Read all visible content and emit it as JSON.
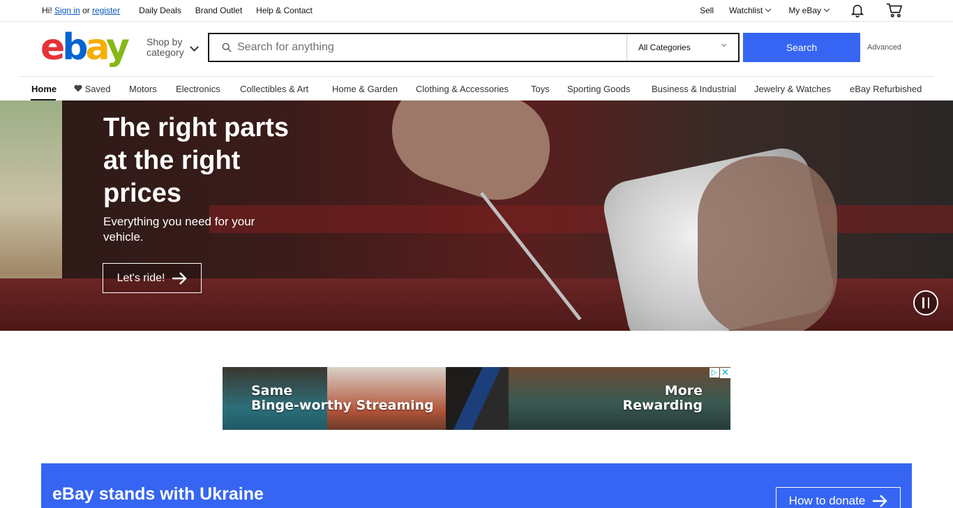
{
  "topbar": {
    "greeting": "Hi!",
    "sign_in": "Sign in",
    "or": "or",
    "register": "register",
    "daily_deals": "Daily Deals",
    "brand_outlet": "Brand Outlet",
    "help": "Help & Contact",
    "sell": "Sell",
    "watchlist": "Watchlist",
    "my_ebay": "My eBay",
    "notification_icon": "bell-icon",
    "cart_icon": "cart-icon"
  },
  "header": {
    "logo": {
      "e": "e",
      "b": "b",
      "a": "a",
      "y": "y"
    },
    "logo_colors": {
      "e": "#e53238",
      "b": "#0064d2",
      "a": "#f5af02",
      "y": "#86b817"
    },
    "shop_by_line1": "Shop by",
    "shop_by_line2": "category",
    "search_placeholder": "Search for anything",
    "search_value": "",
    "category_selected": "All Categories",
    "search_button": "Search",
    "advanced": "Advanced",
    "accent": "#3665f3"
  },
  "nav": {
    "items": [
      {
        "label": "Home",
        "active": true
      },
      {
        "label": "Saved",
        "icon": "heart-icon"
      },
      {
        "label": "Motors"
      },
      {
        "label": "Electronics"
      },
      {
        "label": "Collectibles & Art"
      },
      {
        "label": "Home & Garden"
      },
      {
        "label": "Clothing & Accessories"
      },
      {
        "label": "Toys"
      },
      {
        "label": "Sporting Goods"
      },
      {
        "label": "Business & Industrial"
      },
      {
        "label": "Jewelry & Watches"
      },
      {
        "label": "eBay Refurbished"
      }
    ]
  },
  "hero": {
    "title": "The right parts at the right prices",
    "subtitle": "Everything you need for your vehicle.",
    "cta": "Let's ride!",
    "cta_icon": "arrow-right-icon",
    "pause_icon": "pause-icon"
  },
  "ad": {
    "left_line1": "Same",
    "left_line2": "Binge-worthy Streaming",
    "right_line1": "More",
    "right_line2": "Rewarding",
    "choices_icon": "adchoices-icon",
    "close_icon": "close-icon"
  },
  "ukraine": {
    "title": "eBay stands with Ukraine",
    "button": "How to donate",
    "button_icon": "arrow-right-icon"
  }
}
